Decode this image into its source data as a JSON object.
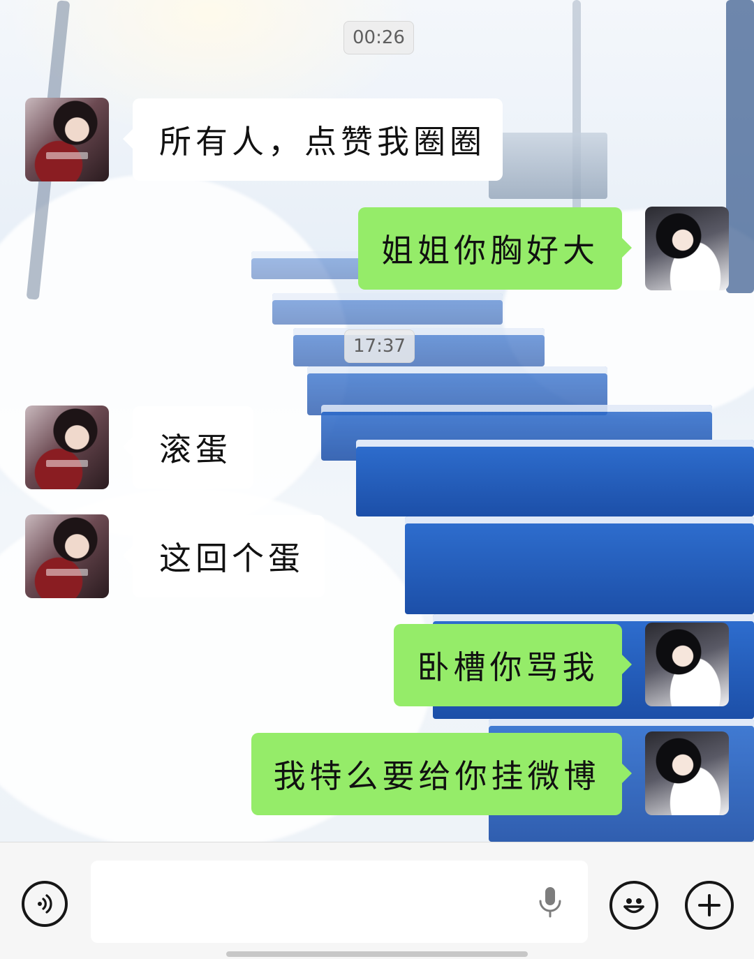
{
  "timestamps": [
    "00:26",
    "17:37"
  ],
  "messages": [
    {
      "side": "left",
      "text": "所有人，点赞我圈圈"
    },
    {
      "side": "right",
      "text": "姐姐你胸好大"
    },
    {
      "side": "left",
      "text": "滚蛋"
    },
    {
      "side": "left",
      "text": "这回个蛋"
    },
    {
      "side": "right",
      "text": "卧槽你骂我"
    },
    {
      "side": "right",
      "text": "我特么要给你挂微博"
    }
  ],
  "input": {
    "value": "",
    "placeholder": ""
  },
  "icons": {
    "voice": "voice-toggle-icon",
    "mic": "microphone-icon",
    "emoji": "emoji-icon",
    "plus": "plus-icon"
  },
  "colors": {
    "outgoing_bubble": "#95ec69",
    "incoming_bubble": "#ffffff",
    "input_bar": "#f6f6f6"
  }
}
